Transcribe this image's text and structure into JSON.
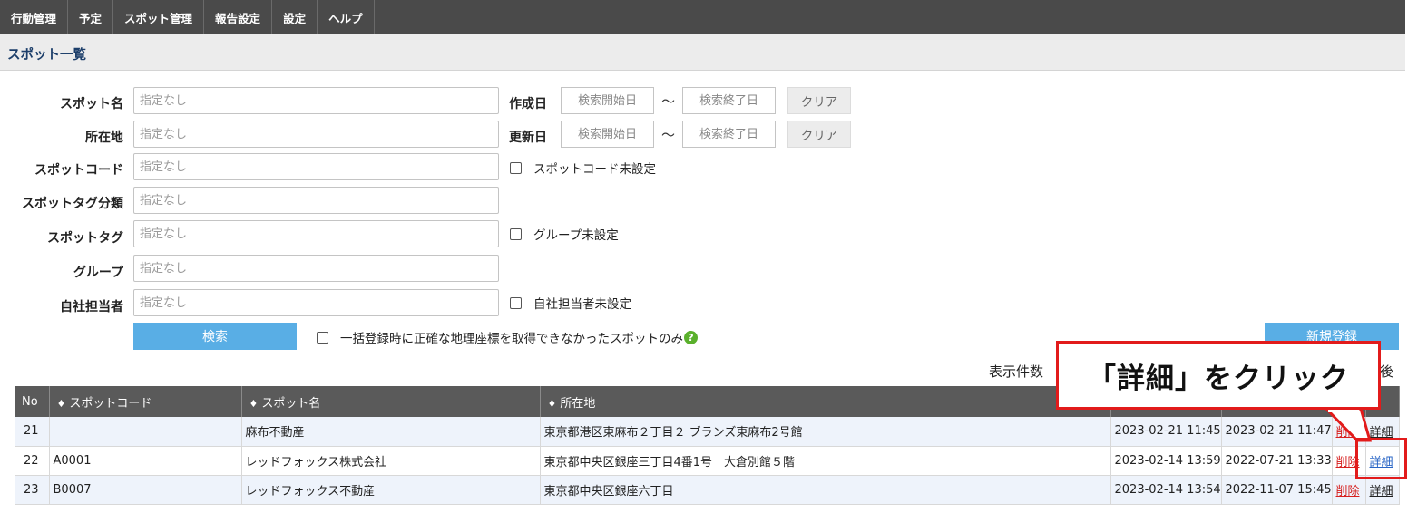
{
  "nav": {
    "items": [
      "行動管理",
      "予定",
      "スポット管理",
      "報告設定",
      "設定",
      "ヘルプ"
    ]
  },
  "page": {
    "title": "スポット一覧"
  },
  "form": {
    "spot_name": {
      "label": "スポット名",
      "placeholder": "指定なし"
    },
    "address": {
      "label": "所在地",
      "placeholder": "指定なし"
    },
    "spot_code": {
      "label": "スポットコード",
      "placeholder": "指定なし"
    },
    "spot_tag_category": {
      "label": "スポットタグ分類",
      "placeholder": "指定なし"
    },
    "spot_tag": {
      "label": "スポットタグ",
      "placeholder": "指定なし"
    },
    "group": {
      "label": "グループ",
      "placeholder": "指定なし"
    },
    "staff": {
      "label": "自社担当者",
      "placeholder": "指定なし"
    },
    "created": {
      "label": "作成日",
      "start_placeholder": "検索開始日",
      "end_placeholder": "検索終了日",
      "clear": "クリア"
    },
    "updated": {
      "label": "更新日",
      "start_placeholder": "検索開始日",
      "end_placeholder": "検索終了日",
      "clear": "クリア"
    },
    "tilde": "〜",
    "check_code_unset": "スポットコード未設定",
    "check_group_unset": "グループ未設定",
    "check_staff_unset": "自社担当者未設定",
    "check_bulk_geo": "一括登録時に正確な地理座標を取得できなかったスポットのみ",
    "help_icon": "?",
    "search_button": "検索",
    "new_button": "新規登録"
  },
  "list": {
    "per_page_label": "表示件数",
    "last_label": "後"
  },
  "table": {
    "headers": {
      "no": "No",
      "code": "スポットコード",
      "name": "スポット名",
      "address": "所在地",
      "sort_icon": "♦"
    },
    "rows": [
      {
        "no": "21",
        "code": "",
        "name": "麻布不動産",
        "address": "東京都港区東麻布２丁目２ ブランズ東麻布2号館",
        "created": "2023-02-21 11:45",
        "updated": "2023-02-21 11:47",
        "delete": "削除",
        "detail": "詳細"
      },
      {
        "no": "22",
        "code": "A0001",
        "name": "レッドフォックス株式会社",
        "address": "東京都中央区銀座三丁目4番1号　大倉別館５階",
        "created": "2023-02-14 13:59",
        "updated": "2022-07-21 13:33",
        "delete": "削除",
        "detail": "詳細"
      },
      {
        "no": "23",
        "code": "B0007",
        "name": "レッドフォックス不動産",
        "address": "東京都中央区銀座六丁目",
        "created": "2023-02-14 13:54",
        "updated": "2022-11-07 15:45",
        "delete": "削除",
        "detail": "詳細"
      }
    ]
  },
  "annotation": {
    "text": "「詳細」をクリック",
    "color": "#e21b1b"
  }
}
